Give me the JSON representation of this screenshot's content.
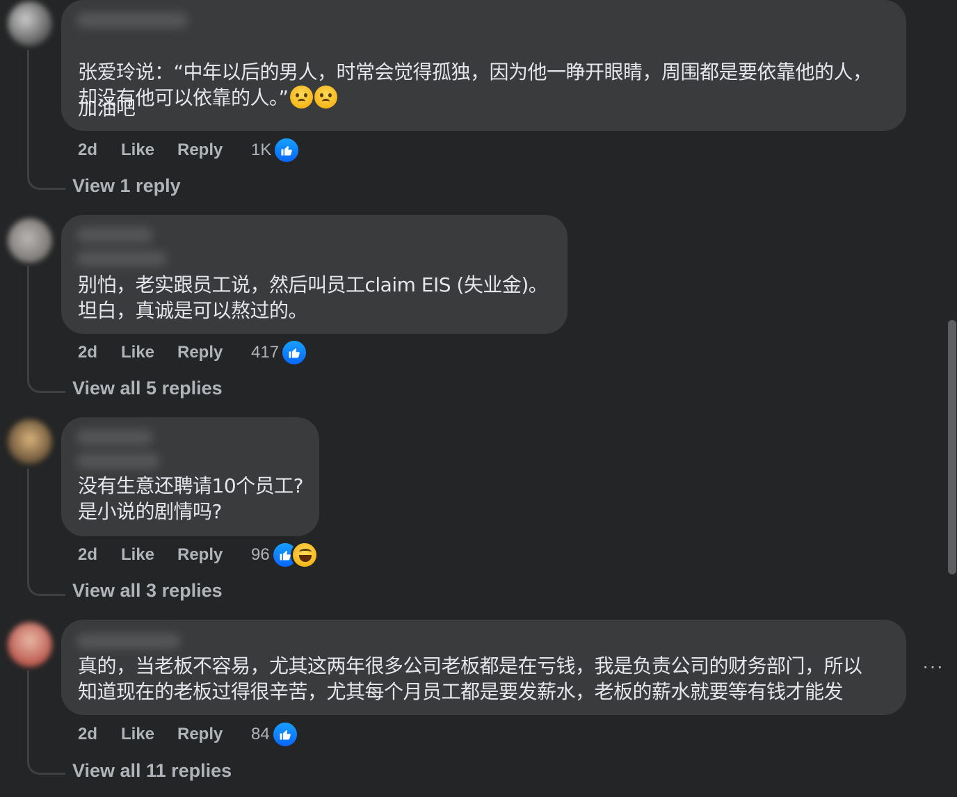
{
  "comments": [
    {
      "body": "张爱玲说：“中年以后的男人，时常会觉得孤独，因为他一睁开眼睛，周围都是要依靠他的人，\n却没有他可以依靠的人。”",
      "body2": "加油吧",
      "emojis": [
        "crying-face",
        "crying-face"
      ],
      "time": "2d",
      "like": "Like",
      "reply": "Reply",
      "reaction_count": "1K",
      "reactions": [
        "like"
      ],
      "view_replies": "View 1 reply"
    },
    {
      "body": "别怕，老实跟员工说，然后叫员工claim EIS (失业金)。\n坦白，真诚是可以熬过的。",
      "time": "2d",
      "like": "Like",
      "reply": "Reply",
      "reaction_count": "417",
      "reactions": [
        "like"
      ],
      "view_replies": "View all 5 replies"
    },
    {
      "body": "没有生意还聘请10个员工?\n是小说的剧情吗?",
      "time": "2d",
      "like": "Like",
      "reply": "Reply",
      "reaction_count": "96",
      "reactions": [
        "like",
        "haha"
      ],
      "view_replies": "View all 3 replies"
    },
    {
      "body": "真的，当老板不容易，尤其这两年很多公司老板都是在亏钱，我是负责公司的财务部门，所以\n知道现在的老板过得很辛苦，尤其每个月员工都是要发薪水，老板的薪水就要等有钱才能发",
      "time": "2d",
      "like": "Like",
      "reply": "Reply",
      "reaction_count": "84",
      "reactions": [
        "like"
      ],
      "view_replies": "View all 11 replies",
      "more": "···"
    }
  ],
  "colors": {
    "background": "#242526",
    "bubble": "#3a3b3c",
    "text": "#e4e6eb",
    "secondary_text": "#b0b3b8",
    "like_blue": "#0866ff"
  }
}
